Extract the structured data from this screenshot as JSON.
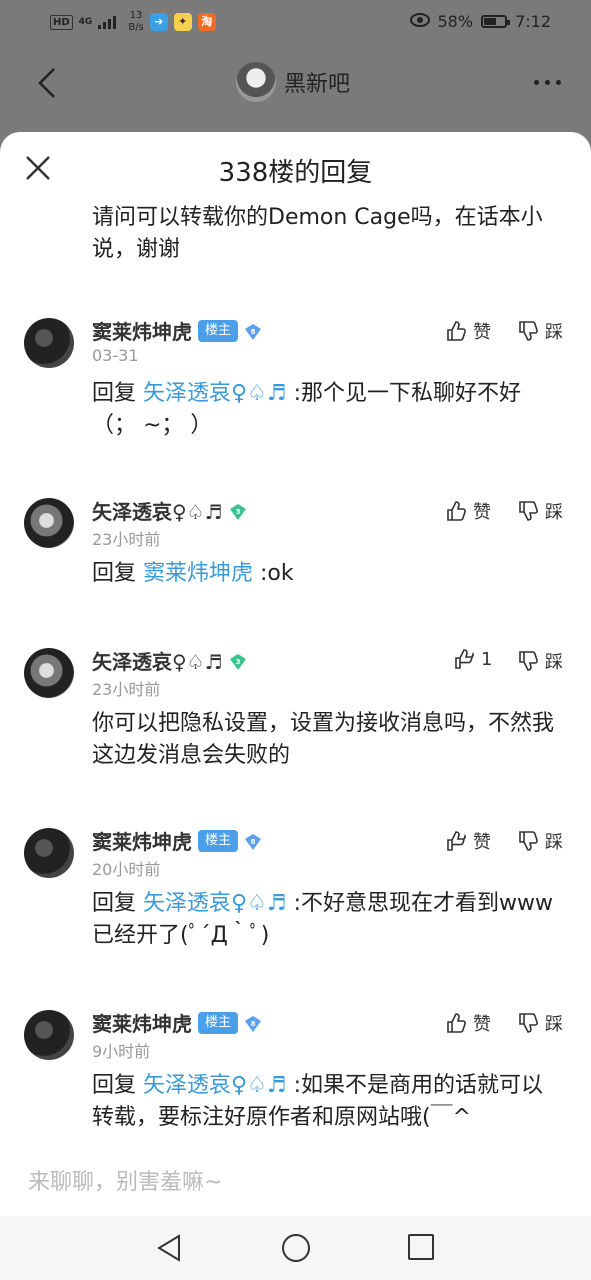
{
  "status_bar": {
    "net_tag": "HD",
    "net_gen": "4G",
    "speed_value": "13",
    "speed_unit": "B/s",
    "app_icon_3": "淘",
    "battery": "58%",
    "time": "7:12"
  },
  "header": {
    "forum_name": "黑新吧"
  },
  "sheet": {
    "title": "338楼的回复",
    "top_text": "请问可以转载你的Demon Cage吗，在话本小说，谢谢",
    "input_placeholder": "来聊聊，别害羞嘛~"
  },
  "colors": {
    "mention": "#3a9ad9",
    "host_badge": "#4a9fe8",
    "level_gem_blue": "#5b9ff0",
    "level_gem_green": "#3dc28f"
  },
  "comments": [
    {
      "user": "窦莱炜坤虎",
      "is_host": true,
      "host_label": "楼主",
      "level": "8",
      "time": "03-31",
      "reply_prefix": "回复",
      "mention": "矢泽透哀♀♤♬",
      "text": " :那个见一下私聊好不好（；  ~；  ）",
      "like_label": "赞",
      "dislike_label": "踩"
    },
    {
      "user": "矢泽透哀♀♤♬",
      "is_host": false,
      "level": "3",
      "time": "23小时前",
      "reply_prefix": "回复",
      "mention": "窦莱炜坤虎",
      "text": " :ok",
      "like_label": "赞",
      "dislike_label": "踩"
    },
    {
      "user": "矢泽透哀♀♤♬",
      "is_host": false,
      "level": "3",
      "time": "23小时前",
      "reply_prefix": "",
      "mention": "",
      "text": "你可以把隐私设置，设置为接收消息吗，不然我这边发消息会失败的",
      "like_label": "1",
      "dislike_label": "踩"
    },
    {
      "user": "窦莱炜坤虎",
      "is_host": true,
      "host_label": "楼主",
      "level": "8",
      "time": "20小时前",
      "reply_prefix": "回复",
      "mention": "矢泽透哀♀♤♬",
      "text": " :不好意思现在才看到www已经开了(ﾟ´Д｀ﾟ)",
      "like_label": "赞",
      "dislike_label": "踩"
    },
    {
      "user": "窦莱炜坤虎",
      "is_host": true,
      "host_label": "楼主",
      "level": "8",
      "time": "9小时前",
      "reply_prefix": "回复",
      "mention": "矢泽透哀♀♤♬",
      "text": " :如果不是商用的话就可以转载，要标注好原作者和原网站哦(￣^",
      "like_label": "赞",
      "dislike_label": "踩"
    }
  ]
}
